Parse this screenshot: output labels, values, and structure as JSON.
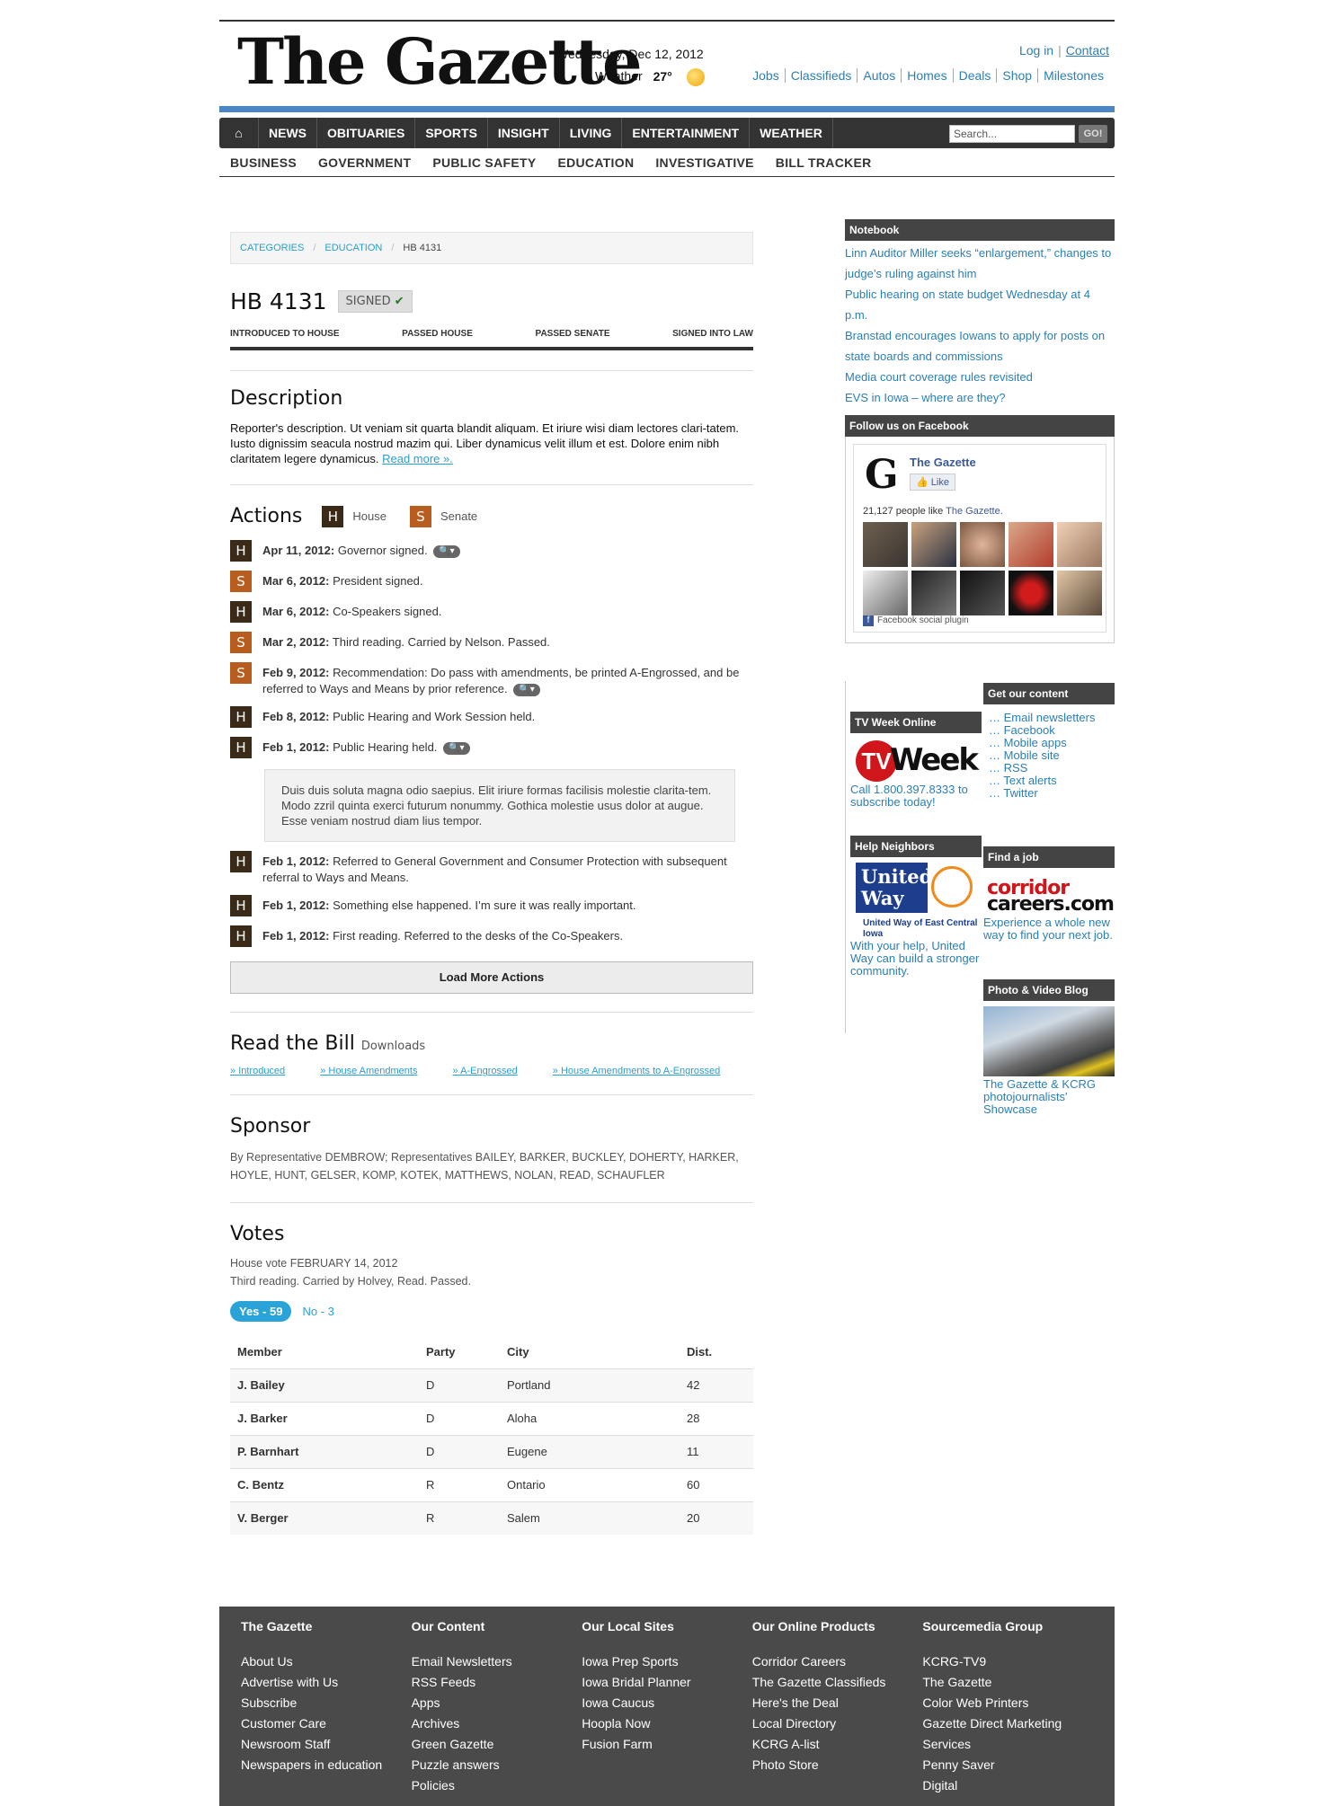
{
  "masthead": {
    "logo": "The Gazette",
    "date": "Wednesday, Dec 12, 2012",
    "weather_label": "Weather",
    "weather_temp": "27°",
    "login": "Log in",
    "contact": "Contact",
    "section_links": [
      "Jobs",
      "Classifieds",
      "Autos",
      "Homes",
      "Deals",
      "Shop",
      "Milestones"
    ]
  },
  "nav": {
    "items": [
      "NEWS",
      "OBITUARIES",
      "SPORTS",
      "INSIGHT",
      "LIVING",
      "ENTERTAINMENT",
      "WEATHER"
    ],
    "search_placeholder": "Search...",
    "go": "GO!",
    "sub": [
      "BUSINESS",
      "GOVERNMENT",
      "PUBLIC SAFETY",
      "EDUCATION",
      "INVESTIGATIVE",
      "BILL TRACKER"
    ]
  },
  "breadcrumb": [
    "CATEGORIES",
    "EDUCATION",
    "HB 4131"
  ],
  "bill": {
    "title": "HB 4131",
    "status": "SIGNED",
    "progress": [
      "INTRODUCED TO HOUSE",
      "PASSED HOUSE",
      "PASSED SENATE",
      "SIGNED INTO LAW"
    ]
  },
  "description": {
    "heading": "Description",
    "text": "Reporter's description. Ut veniam sit quarta blandit aliquam. Et iriure wisi diam lectores clari-tatem. Iusto dignissim seacula nostrud mazim qui. Liber dynamicus velit illum et est. Dolore enim nibh claritatem legere dynamicus.",
    "read_more": "Read more »."
  },
  "actions": {
    "heading": "Actions",
    "legend_house": "House",
    "legend_senate": "Senate",
    "items": [
      {
        "chamber": "H",
        "date": "Apr 11, 2012:",
        "text": "Governor signed.",
        "mag": true
      },
      {
        "chamber": "S",
        "date": "Mar 6, 2012:",
        "text": "President signed.",
        "mag": false
      },
      {
        "chamber": "H",
        "date": "Mar 6, 2012:",
        "text": "Co-Speakers signed.",
        "mag": false
      },
      {
        "chamber": "S",
        "date": "Mar 2, 2012:",
        "text": "Third reading. Carried by Nelson. Passed.",
        "mag": false
      },
      {
        "chamber": "S",
        "date": "Feb 9, 2012:",
        "text": "Recommendation: Do pass with amendments, be printed A-Engrossed, and be referred to Ways and Means by prior reference.",
        "mag": true
      },
      {
        "chamber": "H",
        "date": "Feb 8, 2012:",
        "text": "Public Hearing and Work Session held.",
        "mag": false
      },
      {
        "chamber": "H",
        "date": "Feb 1, 2012:",
        "text": "Public Hearing held.",
        "mag": true
      },
      {
        "chamber": "H",
        "date": "Feb 1, 2012:",
        "text": "Referred to General Government and Consumer Protection with subsequent referral to Ways and Means.",
        "mag": false
      },
      {
        "chamber": "H",
        "date": "Feb 1, 2012:",
        "text": "Something else happened. I’m sure it was really important.",
        "mag": false
      },
      {
        "chamber": "H",
        "date": "Feb 1, 2012:",
        "text": "First reading. Referred to the desks of the Co-Speakers.",
        "mag": false
      }
    ],
    "note": "Duis duis soluta magna odio saepius. Elit iriure formas facilisis molestie clarita-tem. Modo zzril quinta exerci futurum nonummy. Gothica molestie usus dolor at augue. Esse veniam nostrud diam lius tempor.",
    "load_more": "Load More Actions"
  },
  "read_bill": {
    "heading": "Read the Bill",
    "sub": "Downloads",
    "links": [
      "Introduced",
      "House Amendments",
      "A-Engrossed",
      "House Amendments to A-Engrossed"
    ]
  },
  "sponsor": {
    "heading": "Sponsor",
    "text": "By Representative DEMBROW; Representatives BAILEY, BARKER, BUCKLEY, DOHERTY, HARKER, HOYLE, HUNT, GELSER, KOMP, KOTEK, MATTHEWS, NOLAN, READ, SCHAUFLER"
  },
  "votes": {
    "heading": "Votes",
    "meta1": "House vote FEBRUARY 14, 2012",
    "meta2": "Third reading. Carried by Holvey, Read. Passed.",
    "yes": "Yes - 59",
    "no": "No - 3",
    "columns": [
      "Member",
      "Party",
      "City",
      "Dist."
    ],
    "rows": [
      [
        "J. Bailey",
        "D",
        "Portland",
        "42"
      ],
      [
        "J. Barker",
        "D",
        "Aloha",
        "28"
      ],
      [
        "P. Barnhart",
        "D",
        "Eugene",
        "11"
      ],
      [
        "C. Bentz",
        "R",
        "Ontario",
        "60"
      ],
      [
        "V. Berger",
        "R",
        "Salem",
        "20"
      ]
    ]
  },
  "sidebar": {
    "notebook_title": "Notebook",
    "notebook": [
      "Linn Auditor Miller seeks “enlargement,” changes to judge’s ruling against him",
      "Public hearing on state budget Wednesday at 4 p.m.",
      "Branstad encourages Iowans to apply for posts on state boards and commissions",
      "Media court coverage rules revisited",
      "EVS in Iowa – where are they?"
    ],
    "facebook_title": "Follow us on Facebook",
    "fb_name": "The Gazette",
    "fb_like": "Like",
    "fb_count": "21,127 people like",
    "fb_count_name": "The Gazette.",
    "fb_plugin": "Facebook social plugin",
    "tvweek_title": "TV Week Online",
    "tvweek_text": "Call 1.800.397.8333 to subscribe today!",
    "helpneighbors_title": "Help Neighbors",
    "unitedway_logo": "United Way",
    "unitedway_sub": "United Way of East Central Iowa",
    "unitedway_text": "With your help, United Way can build a stronger community.",
    "getcontent_title": "Get our content",
    "getcontent": [
      "… Email newsletters",
      "… Facebook",
      "… Mobile apps",
      "… Mobile site",
      "… RSS",
      "… Text alerts",
      "… Twitter"
    ],
    "findjob_title": "Find a job",
    "careers_logo_1": "corridor",
    "careers_logo_2": "careers.com",
    "findjob_text": "Experience a whole new way to find your next job.",
    "photo_title": "Photo & Video Blog",
    "photo_text": "The Gazette & KCRG photojournalists' Showcase"
  },
  "footer": [
    {
      "title": "The Gazette",
      "links": [
        "About Us",
        "Advertise with Us",
        "Subscribe",
        "Customer Care",
        "Newsroom Staff",
        "Newspapers in education"
      ]
    },
    {
      "title": "Our Content",
      "links": [
        "Email Newsletters",
        "RSS Feeds",
        "Apps",
        "Archives",
        "Green Gazette",
        "Puzzle answers",
        "Policies"
      ]
    },
    {
      "title": "Our Local Sites",
      "links": [
        "Iowa Prep Sports",
        "Iowa Bridal Planner",
        "Iowa Caucus",
        "Hoopla Now",
        "Fusion Farm"
      ]
    },
    {
      "title": "Our Online Products",
      "links": [
        "Corridor Careers",
        "The Gazette Classifieds",
        "Here's the Deal",
        "Local Directory",
        "KCRG A-list",
        "Photo Store"
      ]
    },
    {
      "title": "Sourcemedia Group",
      "links": [
        "KCRG-TV9",
        "The Gazette",
        "Color Web Printers",
        "Gazette Direct Marketing",
        "Services",
        "Penny Saver",
        "Digital"
      ]
    }
  ]
}
